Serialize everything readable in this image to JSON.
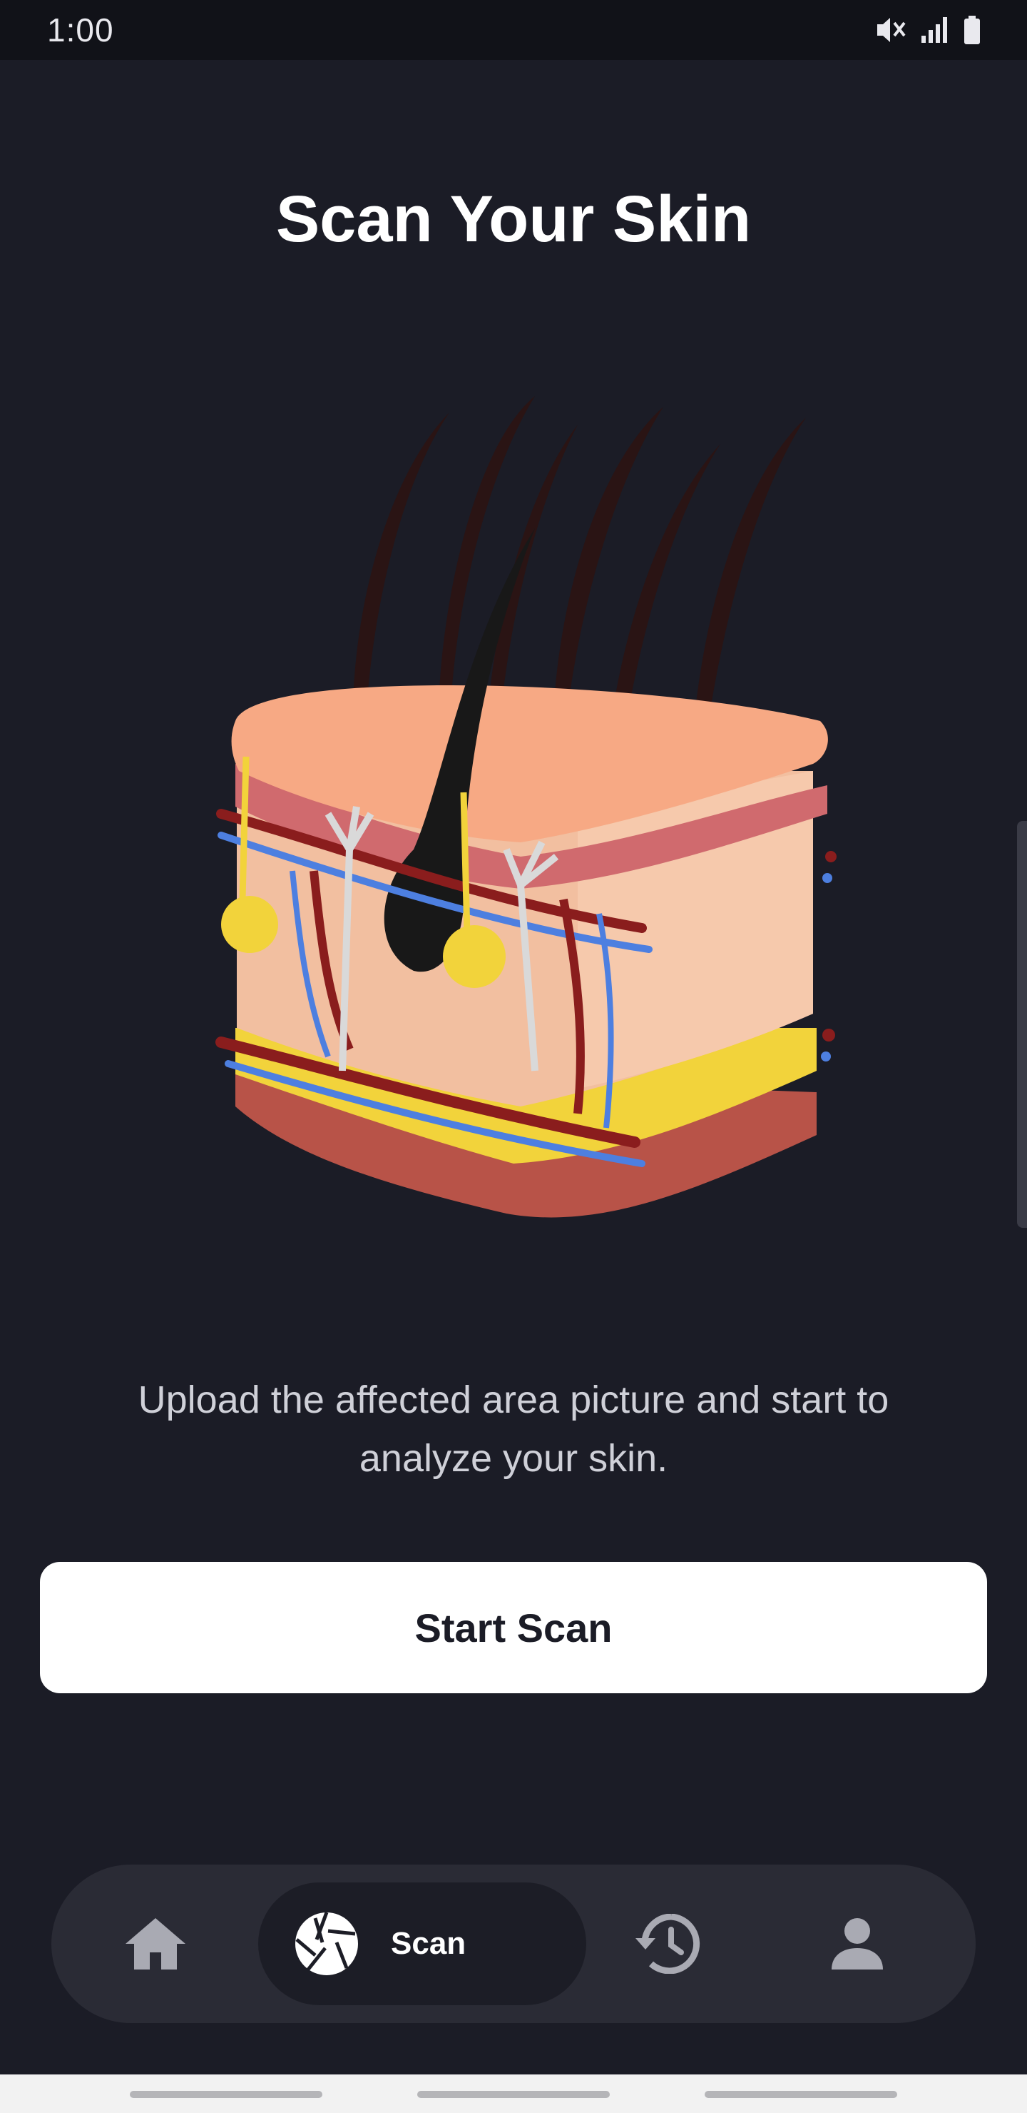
{
  "status_bar": {
    "time": "1:00"
  },
  "page": {
    "title": "Scan Your Skin",
    "description": "Upload the affected area picture and start to analyze your skin.",
    "start_button_label": "Start Scan"
  },
  "bottom_nav": {
    "items": [
      {
        "icon": "home-icon",
        "label": ""
      },
      {
        "icon": "camera-shutter-icon",
        "label": "Scan",
        "active": true
      },
      {
        "icon": "history-icon",
        "label": ""
      },
      {
        "icon": "person-icon",
        "label": ""
      }
    ]
  },
  "colors": {
    "background": "#1b1c26",
    "nav_background": "#2a2b35",
    "button_background": "#ffffff",
    "button_text": "#1b1c26"
  }
}
